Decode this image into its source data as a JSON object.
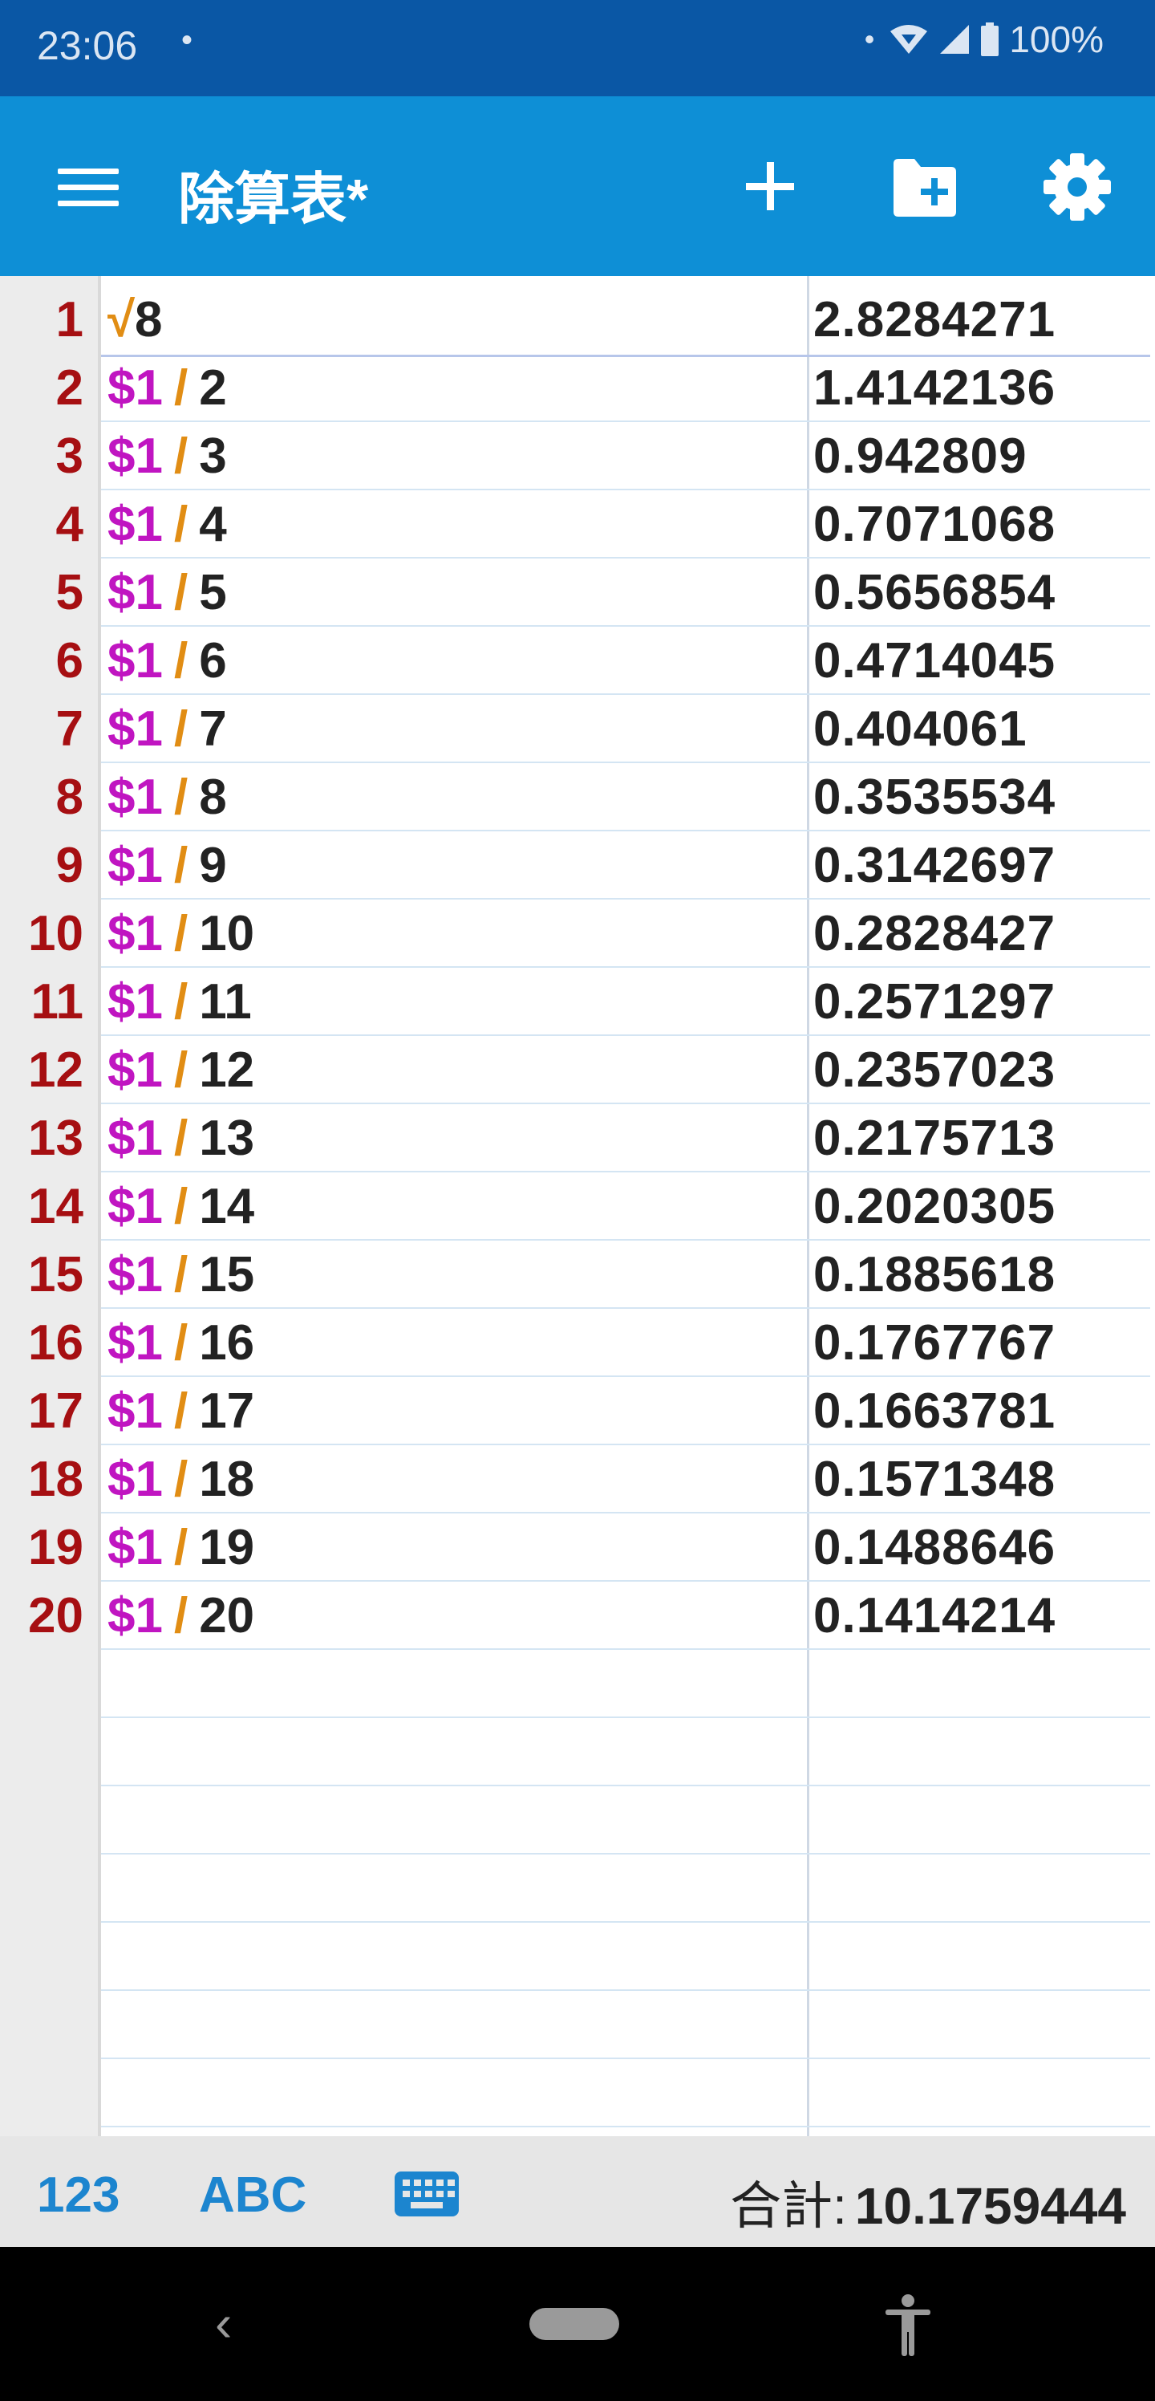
{
  "status_bar": {
    "time": "23:06",
    "notification_dot": "•",
    "battery_percent": "100%",
    "icons": [
      "dot-icon",
      "wifi-icon",
      "signal-icon",
      "battery-icon"
    ]
  },
  "app_bar": {
    "title": "除算表*",
    "icons": [
      "menu-icon",
      "add-icon",
      "folder-add-icon",
      "gear-icon"
    ]
  },
  "rows": [
    {
      "num": "1",
      "ref": "",
      "op": "√",
      "arg": "8",
      "result": "2.8284271"
    },
    {
      "num": "2",
      "ref": "$1",
      "op": "/",
      "arg": "2",
      "result": "1.4142136"
    },
    {
      "num": "3",
      "ref": "$1",
      "op": "/",
      "arg": "3",
      "result": "0.942809"
    },
    {
      "num": "4",
      "ref": "$1",
      "op": "/",
      "arg": "4",
      "result": "0.7071068"
    },
    {
      "num": "5",
      "ref": "$1",
      "op": "/",
      "arg": "5",
      "result": "0.5656854"
    },
    {
      "num": "6",
      "ref": "$1",
      "op": "/",
      "arg": "6",
      "result": "0.4714045"
    },
    {
      "num": "7",
      "ref": "$1",
      "op": "/",
      "arg": "7",
      "result": "0.404061"
    },
    {
      "num": "8",
      "ref": "$1",
      "op": "/",
      "arg": "8",
      "result": "0.3535534"
    },
    {
      "num": "9",
      "ref": "$1",
      "op": "/",
      "arg": "9",
      "result": "0.3142697"
    },
    {
      "num": "10",
      "ref": "$1",
      "op": "/",
      "arg": "10",
      "result": "0.2828427"
    },
    {
      "num": "11",
      "ref": "$1",
      "op": "/",
      "arg": "11",
      "result": "0.2571297"
    },
    {
      "num": "12",
      "ref": "$1",
      "op": "/",
      "arg": "12",
      "result": "0.2357023"
    },
    {
      "num": "13",
      "ref": "$1",
      "op": "/",
      "arg": "13",
      "result": "0.2175713"
    },
    {
      "num": "14",
      "ref": "$1",
      "op": "/",
      "arg": "14",
      "result": "0.2020305"
    },
    {
      "num": "15",
      "ref": "$1",
      "op": "/",
      "arg": "15",
      "result": "0.1885618"
    },
    {
      "num": "16",
      "ref": "$1",
      "op": "/",
      "arg": "16",
      "result": "0.1767767"
    },
    {
      "num": "17",
      "ref": "$1",
      "op": "/",
      "arg": "17",
      "result": "0.1663781"
    },
    {
      "num": "18",
      "ref": "$1",
      "op": "/",
      "arg": "18",
      "result": "0.1571348"
    },
    {
      "num": "19",
      "ref": "$1",
      "op": "/",
      "arg": "19",
      "result": "0.1488646"
    },
    {
      "num": "20",
      "ref": "$1",
      "op": "/",
      "arg": "20",
      "result": "0.1414214"
    }
  ],
  "bottom_bar": {
    "numeric_label": "123",
    "alpha_label": "ABC",
    "keyboard_icon": "keyboard-icon",
    "total_label": "合計:",
    "total_value": "10.1759444"
  },
  "nav_bar": {
    "back_glyph": "‹",
    "icons": [
      "back-icon",
      "home-pill-icon",
      "accessibility-icon"
    ]
  },
  "colors": {
    "status_bar": "#0a57a5",
    "app_bar": "#0e8fd6",
    "row_number": "#a60f12",
    "reference": "#c015c1",
    "operator": "#e18d14",
    "accent": "#1c85cf"
  }
}
